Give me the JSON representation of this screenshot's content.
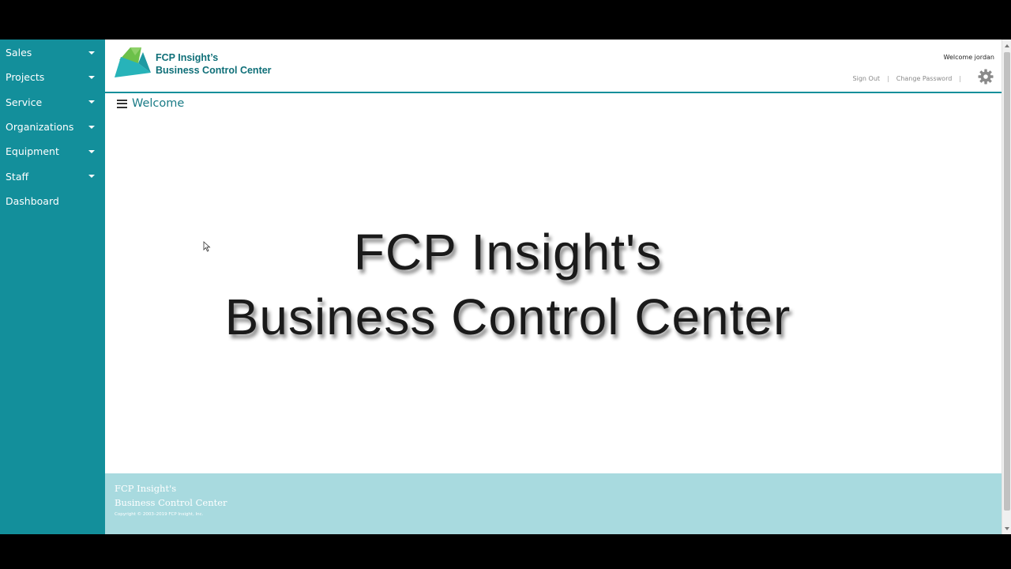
{
  "sidebar": {
    "items": [
      {
        "label": "Sales",
        "has_dropdown": true
      },
      {
        "label": "Projects",
        "has_dropdown": true
      },
      {
        "label": "Service",
        "has_dropdown": true
      },
      {
        "label": "Organizations",
        "has_dropdown": true
      },
      {
        "label": "Equipment",
        "has_dropdown": true
      },
      {
        "label": "Staff",
        "has_dropdown": true
      },
      {
        "label": "Dashboard",
        "has_dropdown": false
      }
    ]
  },
  "header": {
    "logo_line1": "FCP Insight’s",
    "logo_line2": "Business Control Center",
    "welcome": "Welcome jordan",
    "sign_out": "Sign Out",
    "separator": "|",
    "change_password": "Change Password",
    "settings_icon": "gear-icon"
  },
  "main": {
    "page_title": "Welcome",
    "hero_line1": "FCP Insight's",
    "hero_line2": "Business Control Center"
  },
  "footer": {
    "line1": "FCP Insight's",
    "line2": "Business Control Center",
    "copyright": "Copyright © 2003–2019 FCP Insight, Inc."
  },
  "colors": {
    "sidebar": "#138f9b",
    "accent": "#1a7b86",
    "footer": "#a8dadf",
    "logo_green": "#6cc04a",
    "logo_teal": "#27b3b9"
  }
}
